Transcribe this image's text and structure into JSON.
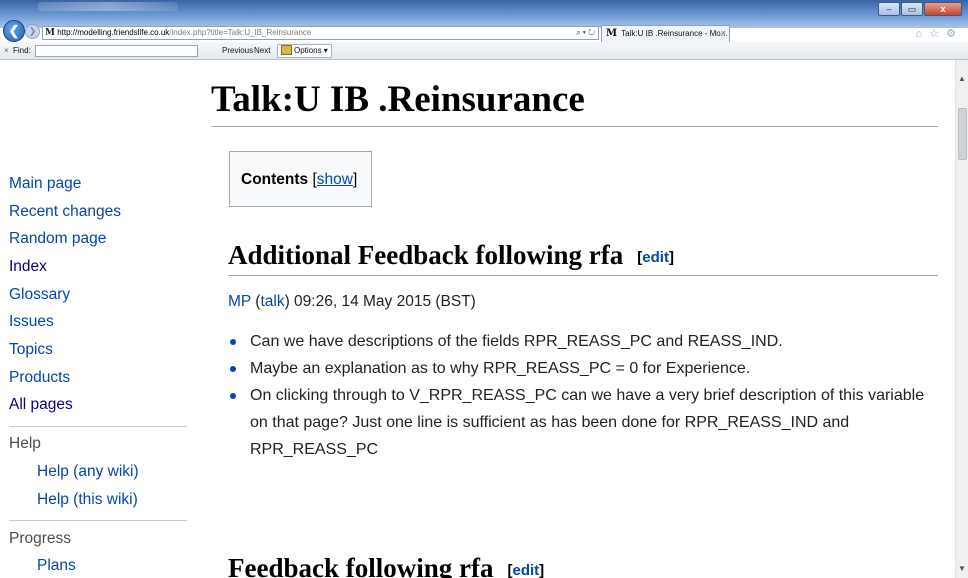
{
  "browser": {
    "address": {
      "host": "http://modelling.friendslife.co.uk",
      "path": "/index.php?title=Talk:U_IB_Reinsurance",
      "site_icon": "M",
      "controls": "⌕ ▾ ↻"
    },
    "tab": {
      "icon": "M",
      "title": "Talk:U IB .Reinsurance - Mo...",
      "close": "×"
    },
    "window_controls": {
      "minimize": "–",
      "maximize": "▭",
      "close": "x"
    },
    "right_icons": "⌂ ☆ ⚙",
    "back_glyph": "❮",
    "forward_glyph": "❯"
  },
  "findbar": {
    "close": "×",
    "label": "Find:",
    "value": "",
    "previous": "Previous",
    "next": "Next",
    "options": "Options ▾"
  },
  "sidebar": {
    "nav": [
      "Main page",
      "Recent changes",
      "Random page",
      "Index",
      "Glossary",
      "Issues",
      "Topics",
      "Products",
      "All pages"
    ],
    "help_heading": "Help",
    "help_items": [
      "Help (any wiki)",
      "Help (this wiki)"
    ],
    "progress_heading": "Progress",
    "progress_items": [
      "Plans"
    ]
  },
  "page": {
    "title": "Talk:U IB .Reinsurance",
    "toc": {
      "label": "Contents",
      "open": "[",
      "toggle": "show",
      "close": "]"
    },
    "sections": [
      {
        "heading": "Additional Feedback following rfa",
        "edit_open": "[",
        "edit": "edit",
        "edit_close": "]",
        "signature": {
          "user": "MP",
          "open": " (",
          "talk": "talk",
          "rest": ") 09:26, 14 May 2015 (BST)"
        },
        "bullets": [
          "Can we have descriptions of the fields RPR_REASS_PC and REASS_IND.",
          "Maybe an explanation as to why RPR_REASS_PC = 0 for Experience.",
          "On clicking through to V_RPR_REASS_PC can we have a very brief description of this variable on that page? Just one line is sufficient as has been done for RPR_REASS_IND and RPR_REASS_PC"
        ]
      },
      {
        "heading": "Feedback following rfa",
        "edit_open": "[",
        "edit": "edit",
        "edit_close": "]"
      }
    ]
  },
  "scrollbar": {
    "up": "▲",
    "down": "▼",
    "position": 0.08
  },
  "colors": {
    "link": "#0645ad",
    "visited": "#0b0080",
    "text": "#222222",
    "rule": "#a2a9b1"
  }
}
